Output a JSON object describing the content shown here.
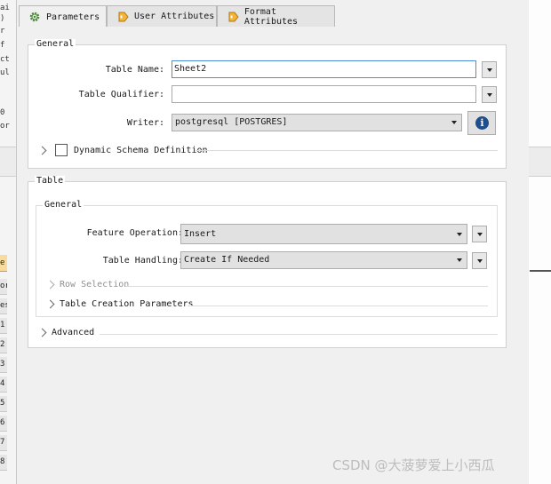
{
  "background": {
    "left_fragments": [
      "ai",
      ")",
      "r",
      "f",
      "ct",
      "ul",
      "a",
      "0",
      "or"
    ],
    "row_fragments": [
      "e",
      "or",
      "es",
      "1",
      "2",
      "3",
      "4",
      "5",
      "6",
      "7",
      "8"
    ]
  },
  "tabs": [
    {
      "label": "Parameters",
      "icon": "gear-icon",
      "active": true
    },
    {
      "label": "User Attributes",
      "icon": "arrow-tag-icon",
      "active": false
    },
    {
      "label": "Format Attributes",
      "icon": "arrow-tag-icon",
      "active": false
    }
  ],
  "general": {
    "title": "General",
    "table_name": {
      "label": "Table Name:",
      "value": "Sheet2"
    },
    "table_qualifier": {
      "label": "Table Qualifier:",
      "value": ""
    },
    "writer": {
      "label": "Writer:",
      "value": "postgresql [POSTGRES]"
    },
    "dynamic_schema": {
      "label": "Dynamic Schema Definition",
      "checked": false
    }
  },
  "table": {
    "title": "Table",
    "general": {
      "title": "General",
      "feature_operation": {
        "label": "Feature Operation:",
        "value": "Insert"
      },
      "table_handling": {
        "label": "Table Handling:",
        "value": "Create If Needed"
      },
      "row_selection": {
        "label": "Row Selection",
        "enabled": false
      },
      "table_creation": {
        "label": "Table Creation Parameters"
      }
    },
    "advanced": {
      "label": "Advanced"
    }
  },
  "watermark": "CSDN @大菠萝爱上小西瓜",
  "colors": {
    "info_icon": "#1f4e8c",
    "focus_border": "#4a90d9",
    "tab_icon": "#e8a020"
  }
}
